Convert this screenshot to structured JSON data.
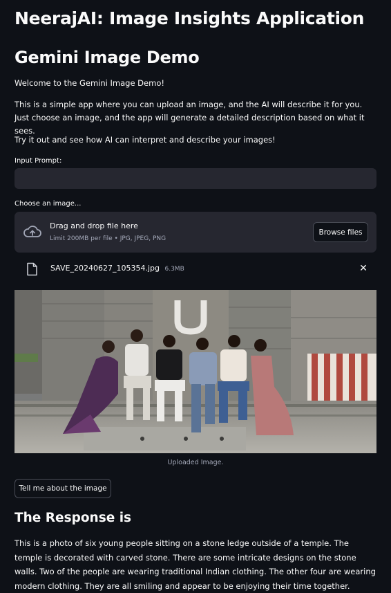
{
  "app": {
    "title": "NeerajAI: Image Insights Application",
    "subtitle": "Gemini Image Demo"
  },
  "intro": {
    "welcome": "Welcome to the Gemini Image Demo!",
    "description": "This is a simple app where you can upload an image, and the AI will describe it for you. Just choose an image, and the app will generate a detailed description based on what it sees.",
    "cta": "Try it out and see how AI can interpret and describe your images!"
  },
  "prompt": {
    "label": "Input Prompt:",
    "value": "",
    "placeholder": ""
  },
  "uploader": {
    "label": "Choose an image...",
    "drag_text": "Drag and drop file here",
    "limit_text": "Limit 200MB per file • JPG, JPEG, PNG",
    "browse_label": "Browse files",
    "icon": "cloud-upload-icon"
  },
  "uploaded_file": {
    "name": "SAVE_20240627_105354.jpg",
    "size": "6.3MB",
    "icon": "file-icon",
    "remove_icon": "close-icon"
  },
  "image": {
    "caption": "Uploaded Image."
  },
  "action": {
    "button_label": "Tell me about the image"
  },
  "response": {
    "heading": "The Response is",
    "text": "This is a photo of six young people sitting on a stone ledge outside of a temple. The temple is decorated with carved stone. There are some intricate designs on the stone walls. Two of the people are wearing traditional Indian clothing. The other four are wearing modern clothing. They are all smiling and appear to be enjoying their time together."
  },
  "colors": {
    "background": "#0e1117",
    "surface": "#262730",
    "text": "#fafafa",
    "muted": "#a3a8b8"
  }
}
